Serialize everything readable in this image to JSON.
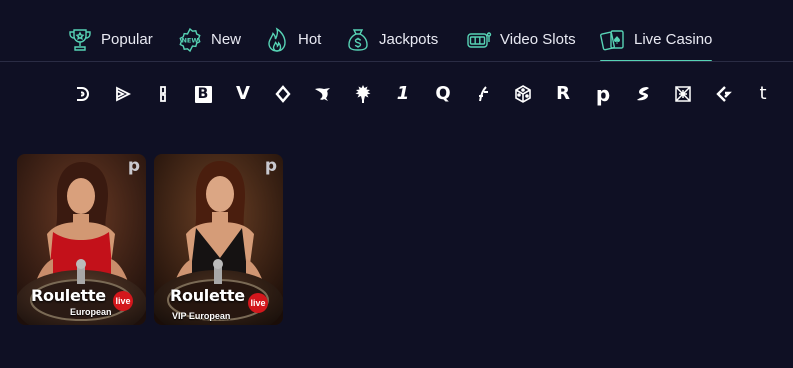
{
  "tabs": [
    {
      "label": "Popular",
      "icon": "trophy-icon",
      "active": false
    },
    {
      "label": "New",
      "icon": "new-badge-icon",
      "active": false
    },
    {
      "label": "Hot",
      "icon": "flame-icon",
      "active": false
    },
    {
      "label": "Jackpots",
      "icon": "money-bag-icon",
      "active": false
    },
    {
      "label": "Video Slots",
      "icon": "slot-machine-icon",
      "active": false
    },
    {
      "label": "Live Casino",
      "icon": "playing-cards-icon",
      "active": true
    }
  ],
  "providers": [
    {
      "icon": "provider-spiral-d-icon"
    },
    {
      "icon": "provider-play-arrows-icon"
    },
    {
      "icon": "provider-bracket-icon"
    },
    {
      "icon": "provider-b-icon",
      "glyph": "B"
    },
    {
      "icon": "provider-v-icon",
      "glyph": "V"
    },
    {
      "icon": "provider-diamond-icon"
    },
    {
      "icon": "provider-dragon-icon"
    },
    {
      "icon": "provider-tree-icon"
    },
    {
      "icon": "provider-1-icon",
      "glyph": "1"
    },
    {
      "icon": "provider-q-icon",
      "glyph": "Q"
    },
    {
      "icon": "provider-slash-icon"
    },
    {
      "icon": "provider-dice-icon"
    },
    {
      "icon": "provider-r-icon",
      "glyph": "R"
    },
    {
      "icon": "provider-p-icon",
      "glyph": "p"
    },
    {
      "icon": "provider-s-icon"
    },
    {
      "icon": "provider-box-icon"
    },
    {
      "icon": "provider-chevron-icon"
    },
    {
      "icon": "provider-t-icon",
      "glyph": "t"
    }
  ],
  "games": [
    {
      "brand": "p",
      "title": "Roulette",
      "badge": "live",
      "subtitle": "European",
      "theme": "red-dress"
    },
    {
      "brand": "p",
      "title": "Roulette",
      "badge": "live",
      "subtitle": "VIP European",
      "theme": "black-dress"
    }
  ],
  "colors": {
    "background": "#0f1024",
    "accent": "#57d3b5",
    "live_badge": "#d3171c"
  }
}
